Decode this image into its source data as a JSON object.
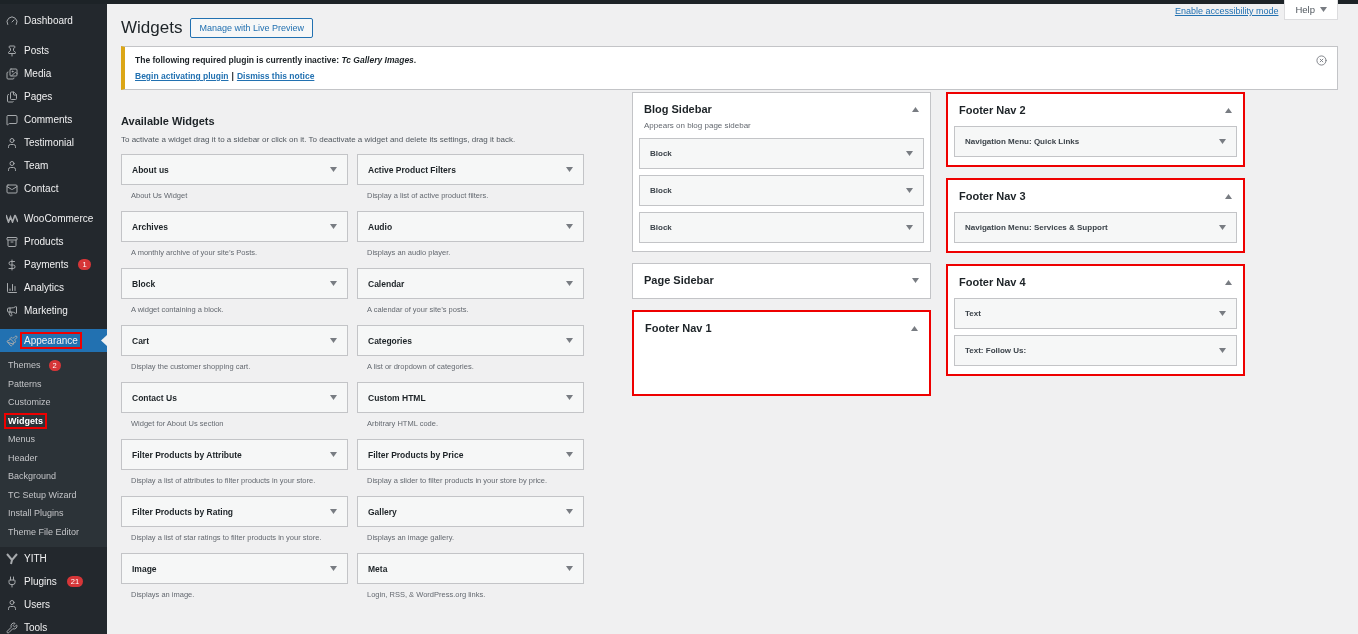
{
  "admin_menu": [
    {
      "items": [
        {
          "label": "Dashboard",
          "selected": false,
          "highlighted": false
        }
      ]
    },
    {
      "items": [
        {
          "label": "Posts",
          "selected": false,
          "highlighted": false
        },
        {
          "label": "Media",
          "selected": false,
          "highlighted": false
        },
        {
          "label": "Pages",
          "selected": false,
          "highlighted": false
        },
        {
          "label": "Comments",
          "selected": false,
          "highlighted": false
        },
        {
          "label": "Testimonial",
          "selected": false,
          "highlighted": false
        },
        {
          "label": "Team",
          "selected": false,
          "highlighted": false
        },
        {
          "label": "Contact",
          "selected": false,
          "highlighted": false
        }
      ]
    },
    {
      "items": [
        {
          "label": "WooCommerce",
          "selected": false,
          "highlighted": false
        },
        {
          "label": "Products",
          "selected": false,
          "highlighted": false
        },
        {
          "label": "Payments",
          "badge": "1",
          "selected": false,
          "highlighted": false
        },
        {
          "label": "Analytics",
          "selected": false,
          "highlighted": false
        },
        {
          "label": "Marketing",
          "selected": false,
          "highlighted": false
        }
      ]
    },
    {
      "items": [
        {
          "label": "Appearance",
          "selected": true,
          "highlighted": true,
          "children": [
            {
              "label": "Themes",
              "badge": "2",
              "selected": false,
              "highlighted": false
            },
            {
              "label": "Patterns",
              "selected": false,
              "highlighted": false
            },
            {
              "label": "Customize",
              "selected": false,
              "highlighted": false
            },
            {
              "label": "Widgets",
              "selected": true,
              "highlighted": true
            },
            {
              "label": "Menus",
              "selected": false,
              "highlighted": false
            },
            {
              "label": "Header",
              "selected": false,
              "highlighted": false
            },
            {
              "label": "Background",
              "selected": false,
              "highlighted": false
            },
            {
              "label": "TC Setup Wizard",
              "selected": false,
              "highlighted": false
            },
            {
              "label": "Install Plugins",
              "selected": false,
              "highlighted": false
            },
            {
              "label": "Theme File Editor",
              "selected": false,
              "highlighted": false
            }
          ]
        },
        {
          "label": "YITH",
          "selected": false,
          "highlighted": false
        },
        {
          "label": "Plugins",
          "badge": "21",
          "selected": false,
          "highlighted": false
        },
        {
          "label": "Users",
          "selected": false,
          "highlighted": false
        },
        {
          "label": "Tools",
          "selected": false,
          "highlighted": false
        }
      ]
    }
  ],
  "screen_links": {
    "accessibility": "Enable accessibility mode",
    "help": "Help"
  },
  "page": {
    "title": "Widgets",
    "action": "Manage with Live Preview"
  },
  "notice": {
    "text": "The following required plugin is currently inactive: *Tc Gallery Images*.",
    "links": [
      "Begin activating plugin",
      "Dismiss this notice"
    ],
    "separator": "|"
  },
  "available_widgets": {
    "title": "Available Widgets",
    "description": "To activate a widget drag it to a sidebar or click on it. To deactivate a widget and delete its settings, drag it back.",
    "widgets": [
      {
        "title": "About us",
        "description": "About Us Widget"
      },
      {
        "title": "Active Product Filters",
        "description": "Display a list of active product filters."
      },
      {
        "title": "Archives",
        "description": "A monthly archive of your site’s Posts."
      },
      {
        "title": "Audio",
        "description": "Displays an audio player."
      },
      {
        "title": "Block",
        "description": "A widget containing a block."
      },
      {
        "title": "Calendar",
        "description": "A calendar of your site’s posts."
      },
      {
        "title": "Cart",
        "description": "Display the customer shopping cart."
      },
      {
        "title": "Categories",
        "description": "A list or dropdown of categories."
      },
      {
        "title": "Contact Us",
        "description": "Widget for About Us section"
      },
      {
        "title": "Custom HTML",
        "description": "Arbitrary HTML code."
      },
      {
        "title": "Filter Products by Attribute",
        "description": "Display a list of attributes to filter products in your store."
      },
      {
        "title": "Filter Products by Price",
        "description": "Display a slider to filter products in your store by price."
      },
      {
        "title": "Filter Products by Rating",
        "description": "Display a list of star ratings to filter products in your store."
      },
      {
        "title": "Gallery",
        "description": "Displays an image gallery."
      },
      {
        "title": "Image",
        "description": "Displays an image."
      },
      {
        "title": "Meta",
        "description": "Login, RSS, & WordPress.org links."
      }
    ]
  },
  "sidebar_columns": [
    {
      "areas": [
        {
          "title": "Blog Sidebar",
          "description": "Appears on blog page sidebar",
          "expanded": true,
          "highlighted": false,
          "widgets": [
            "Block",
            "Block",
            "Block"
          ]
        },
        {
          "title": "Page Sidebar",
          "expanded": false,
          "highlighted": false
        },
        {
          "title": "Footer Nav 1",
          "expanded": true,
          "highlighted": true
        }
      ]
    },
    {
      "areas": [
        {
          "title": "Footer Nav 2",
          "expanded": true,
          "highlighted": true,
          "widgets": [
            "**Navigation Menu:** Quick Links"
          ]
        },
        {
          "title": "Footer Nav 3",
          "expanded": true,
          "highlighted": true,
          "widgets": [
            "**Navigation Menu:** Services & Support"
          ]
        },
        {
          "title": "Footer Nav 4",
          "expanded": true,
          "highlighted": true,
          "widgets": [
            "Text",
            "**Text:** Follow Us:"
          ]
        }
      ]
    }
  ]
}
